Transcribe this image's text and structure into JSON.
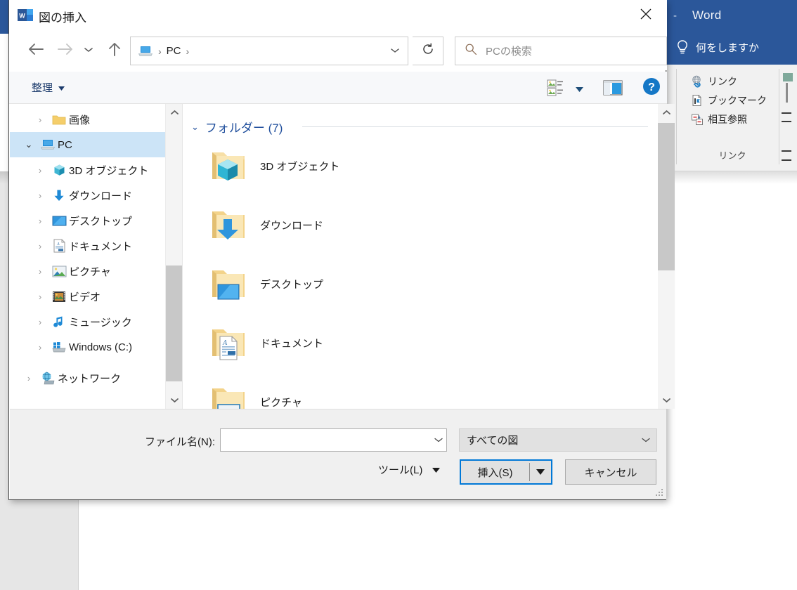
{
  "word": {
    "title_dash": "-",
    "title": "Word",
    "tellme": "何をしますか",
    "tellme_icon": "lightbulb-icon",
    "ribbon": {
      "group_label": "リンク",
      "items": [
        {
          "label": "リンク",
          "icon": "hyperlink-icon"
        },
        {
          "label": "ブックマーク",
          "icon": "bookmark-icon"
        },
        {
          "label": "相互参照",
          "icon": "cross-reference-icon"
        }
      ]
    }
  },
  "dialog": {
    "title": "図の挿入",
    "title_icon": "word-app-icon",
    "close_icon": "close-icon",
    "nav": {
      "back_icon": "arrow-left-icon",
      "forward_icon": "arrow-right-icon",
      "recent_icon": "chevron-down-icon",
      "up_icon": "arrow-up-icon"
    },
    "address": {
      "icon": "pc-icon",
      "crumbs": [
        "PC"
      ],
      "separator": "›",
      "dropdown_icon": "chevron-down-icon"
    },
    "refresh_icon": "refresh-icon",
    "search": {
      "icon": "search-icon",
      "placeholder": "PCの検索"
    },
    "commandbar": {
      "organize": "整理",
      "organize_caret_icon": "caret-down-icon",
      "view_icon": "view-layout-icon",
      "view_caret_icon": "caret-down-icon",
      "preview_pane_icon": "preview-pane-icon",
      "help_icon": "help-icon"
    },
    "navpane": {
      "items": [
        {
          "label": "画像",
          "icon": "folder-icon",
          "indent": 1,
          "selected": false,
          "chevron": "›"
        },
        {
          "label": "PC",
          "icon": "pc-icon",
          "indent": 0,
          "selected": true,
          "chevron": "⌄"
        },
        {
          "label": "3D オブジェクト",
          "icon": "3d-objects-icon",
          "indent": 1,
          "selected": false,
          "chevron": "›"
        },
        {
          "label": "ダウンロード",
          "icon": "downloads-icon",
          "indent": 1,
          "selected": false,
          "chevron": "›"
        },
        {
          "label": "デスクトップ",
          "icon": "desktop-icon",
          "indent": 1,
          "selected": false,
          "chevron": "›"
        },
        {
          "label": "ドキュメント",
          "icon": "documents-icon",
          "indent": 1,
          "selected": false,
          "chevron": "›"
        },
        {
          "label": "ピクチャ",
          "icon": "pictures-icon",
          "indent": 1,
          "selected": false,
          "chevron": "›"
        },
        {
          "label": "ビデオ",
          "icon": "videos-icon",
          "indent": 1,
          "selected": false,
          "chevron": "›"
        },
        {
          "label": "ミュージック",
          "icon": "music-icon",
          "indent": 1,
          "selected": false,
          "chevron": "›"
        },
        {
          "label": "Windows (C:)",
          "icon": "drive-icon",
          "indent": 1,
          "selected": false,
          "chevron": "›"
        },
        {
          "label": "ネットワーク",
          "icon": "network-icon",
          "indent": 0,
          "selected": false,
          "chevron": "›"
        }
      ]
    },
    "filelist": {
      "group_title": "フォルダー (7)",
      "group_chevron": "⌄",
      "items": [
        {
          "label": "3D オブジェクト",
          "icon": "folder-3d-objects-icon"
        },
        {
          "label": "ダウンロード",
          "icon": "folder-downloads-icon"
        },
        {
          "label": "デスクトップ",
          "icon": "folder-desktop-icon"
        },
        {
          "label": "ドキュメント",
          "icon": "folder-documents-icon"
        },
        {
          "label": "ピクチャ",
          "icon": "folder-pictures-icon"
        }
      ]
    },
    "footer": {
      "filename_label": "ファイル名(N):",
      "filename_value": "",
      "filename_placeholder": "",
      "filename_caret_icon": "chevron-down-icon",
      "filter_value": "すべての図",
      "filter_caret_icon": "chevron-down-icon",
      "tools_label": "ツール(L)",
      "tools_caret_icon": "caret-down-icon",
      "insert_label": "挿入(S)",
      "insert_caret_icon": "caret-down-icon",
      "cancel_label": "キャンセル"
    }
  }
}
